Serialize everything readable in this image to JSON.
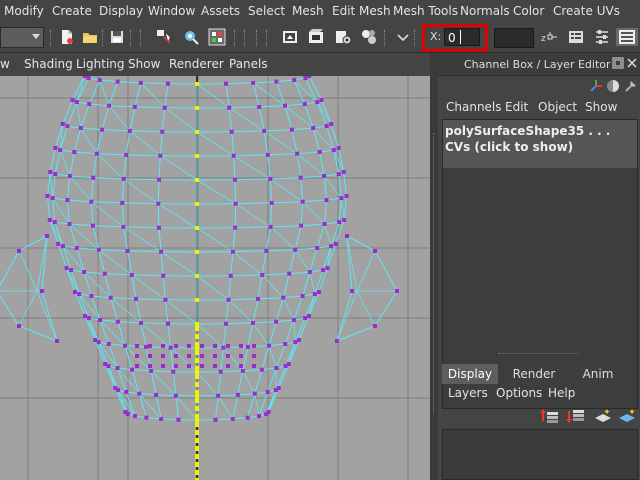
{
  "menubar": {
    "items": [
      "Modify",
      "Create",
      "Display",
      "Window",
      "Assets",
      "Select",
      "Mesh",
      "Edit Mesh",
      "Mesh Tools",
      "Normals",
      "Color",
      "Create UVs"
    ]
  },
  "toolbar": {
    "x_label": "X:",
    "x_value": "0",
    "icons": [
      "new-scene-icon",
      "open-scene-icon",
      "save-scene-icon",
      "select-by-hierarchy-icon",
      "select-by-object-icon",
      "select-by-component-icon",
      "snap-icon",
      "render-icon",
      "ipr-render-icon",
      "render-settings-icon",
      "hypershade-icon",
      "transform-mode-icon",
      "channel-box-toggle-icon",
      "attribute-editor-icon",
      "tool-settings-icon"
    ]
  },
  "viewport": {
    "menu": [
      "w",
      "Shading",
      "Lighting",
      "Show",
      "Renderer",
      "Panels"
    ],
    "background": "#a2a2a2",
    "wire_color": "#5ce8f5",
    "vertex_color": "#9b2bd0",
    "selected_color": "#f0f000"
  },
  "channel_box": {
    "title": "Channel Box / Layer Editor",
    "menu": [
      "Channels",
      "Edit",
      "Object",
      "Show"
    ],
    "shape_name": "polySurfaceShape35 . . .",
    "cvs_label": "CVs (click to show)"
  },
  "layer_editor": {
    "tabs": [
      "Display",
      "Render",
      "Anim"
    ],
    "active_tab": "Display",
    "menu": [
      "Layers",
      "Options",
      "Help"
    ]
  },
  "highlight_color": "#e00000"
}
